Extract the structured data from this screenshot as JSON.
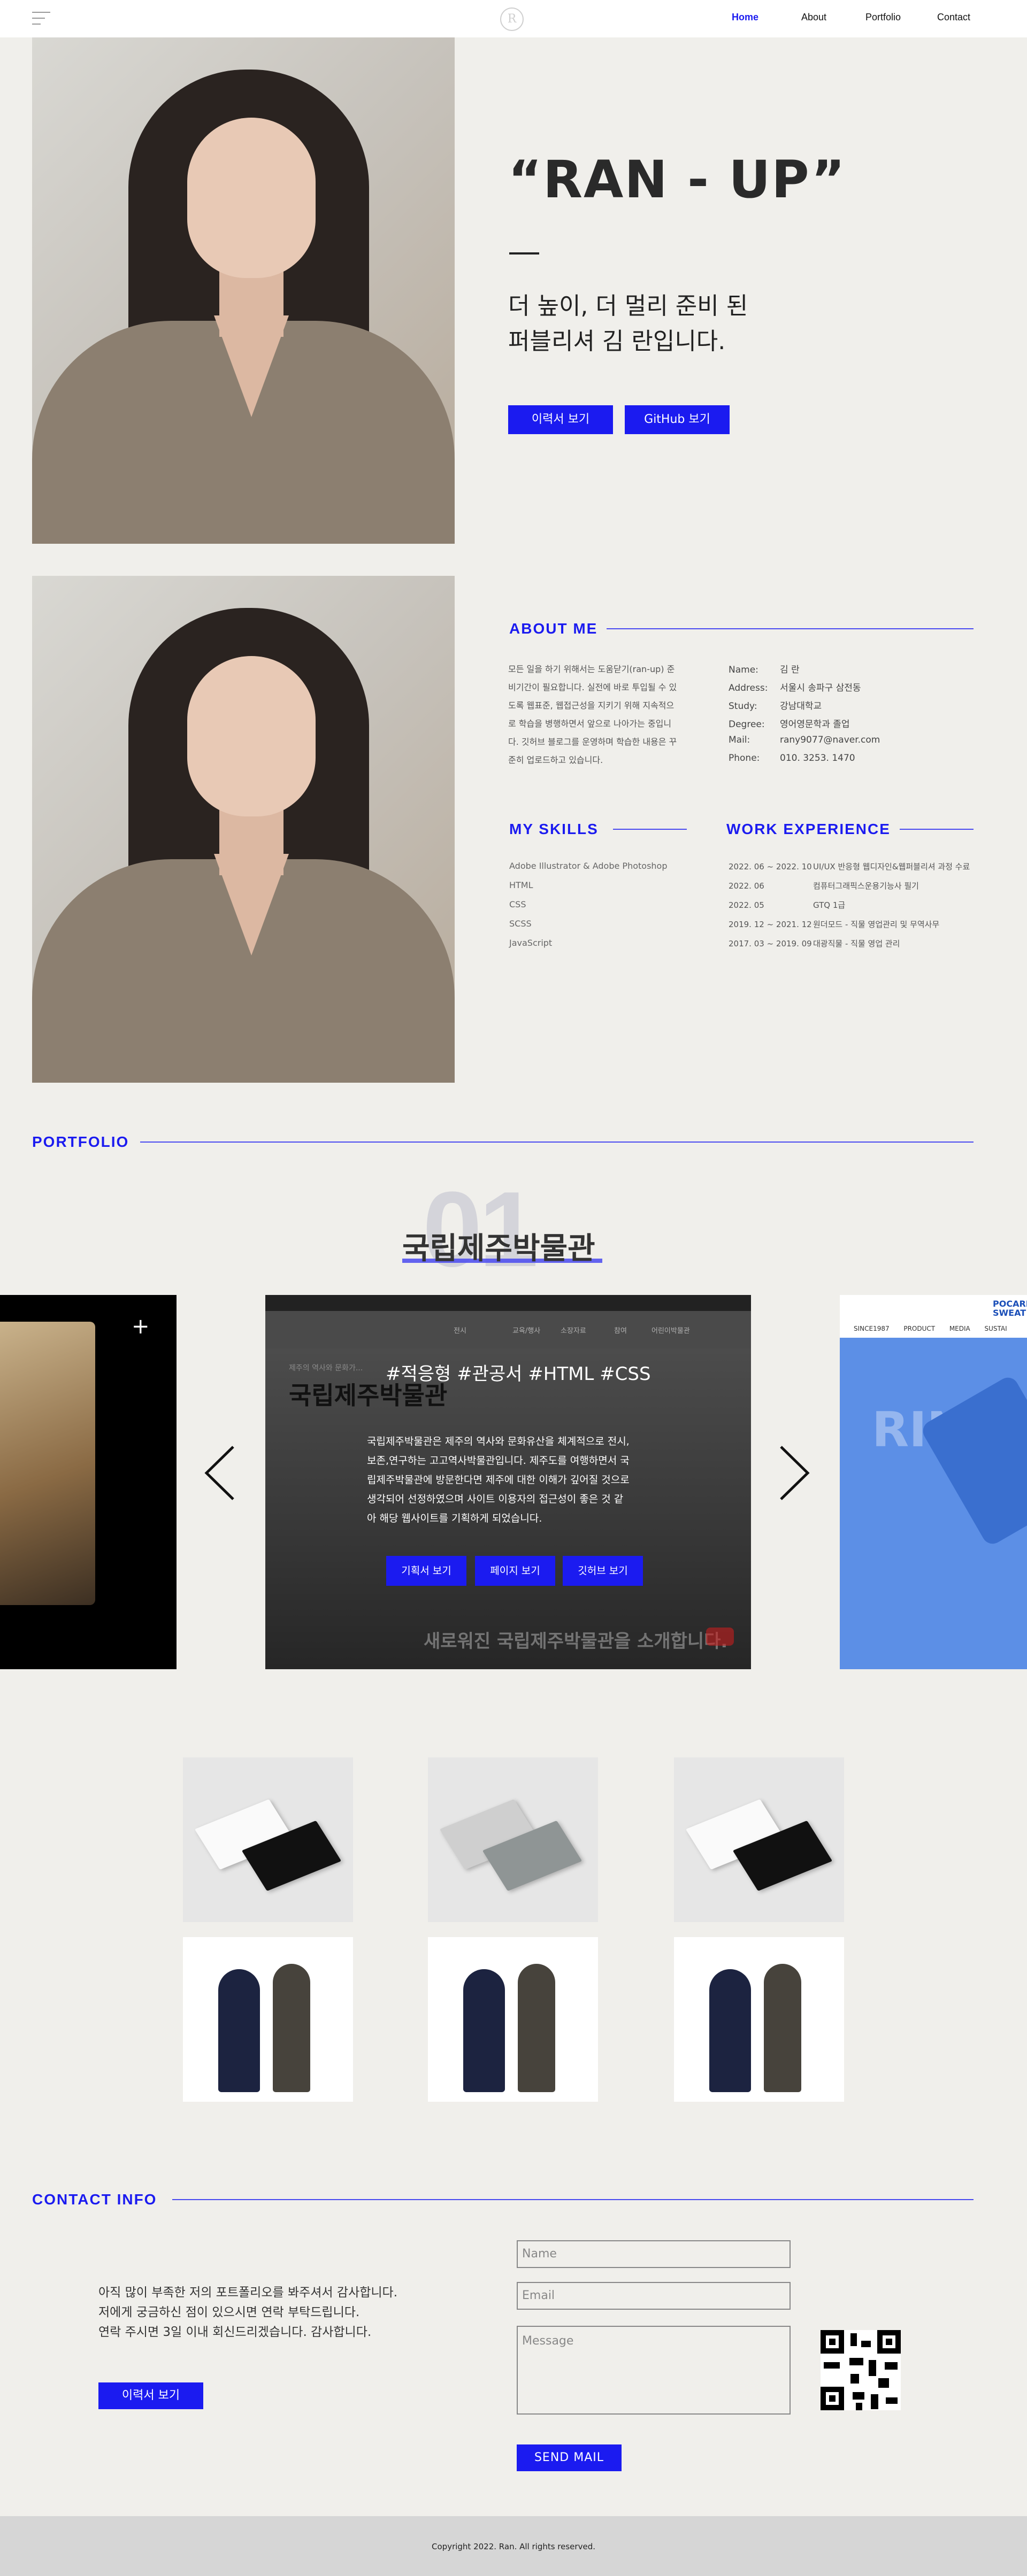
{
  "header": {
    "logo": "R",
    "nav": [
      "Home",
      "About",
      "Portfolio",
      "Contact"
    ]
  },
  "hero": {
    "title": "“RAN - UP”",
    "subtitle_line1": "더 높이, 더 멀리 준비 된",
    "subtitle_line2": "퍼블리셔 김 란입니다.",
    "btn_resume": "이력서 보기",
    "btn_github": "GitHub 보기"
  },
  "about": {
    "title": "ABOUT ME",
    "text": [
      "모든 일을 하기 위해서는 도움닫기(ran-up) 준",
      "비기간이 필요합니다.  실전에 바로 투입될 수 있",
      "도록 웹표준, 웹접근성을 지키기 위해 지속적으",
      "로 학습을 병행하면서 앞으로 나아가는 중입니",
      "다. 깃허브 블로그를 운영하며 학습한 내용은 꾸",
      "준히 업로드하고 있습니다."
    ],
    "info": [
      {
        "label": "Name:",
        "value": "김 란"
      },
      {
        "label": "Address:",
        "value": "서울시 송파구 삼전동"
      },
      {
        "label": "Study:",
        "value": "강남대학교"
      },
      {
        "label": "Degree:",
        "value": "영어영문학과 졸업"
      },
      {
        "label": "Mail:",
        "value": "rany9077@naver.com"
      },
      {
        "label": "Phone:",
        "value": "010. 3253. 1470"
      }
    ]
  },
  "skills": {
    "title": "MY SKILLS",
    "items": [
      "Adobe Illustrator & Adobe Photoshop",
      "HTML",
      "CSS",
      "SCSS",
      "JavaScript"
    ]
  },
  "work": {
    "title": "WORK EXPERIENCE",
    "items": [
      {
        "date": "2022. 06 ~ 2022. 10",
        "desc": "UI/UX 반응형 웹디자인&웹퍼블리셔 과정 수료"
      },
      {
        "date": "2022. 06",
        "desc": "컴퓨터그래픽스운용기능사 필기"
      },
      {
        "date": "2022. 05",
        "desc": "GTQ 1급"
      },
      {
        "date": "2019. 12 ~ 2021. 12",
        "desc": "원더모드 - 직물 영업관리 및 무역사무"
      },
      {
        "date": "2017. 03 ~ 2019. 09",
        "desc": "대광직물 - 직물 영업 관리"
      }
    ]
  },
  "portfolio": {
    "title": "PORTFOLIO",
    "number": "01",
    "project_title": "국립제주박물관",
    "tags": "#적응형 #관공서 #HTML #CSS",
    "slide_heading": "국립제주박물관",
    "slide_desc": [
      "국립제주박물관은 제주의 역사와 문화유산을 체계적으로 전시,",
      "보존,연구하는 고고역사박물관입니다. 제주도를 여행하면서 국",
      "립제주박물관에 방문한다면 제주에 대한 이해가 깊어질 것으로",
      "생각되어 선정하였으며 사이트 이용자의 접근성이 좋은 것 같",
      "아 해당 웹사이트를 기획하게 되었습니다."
    ],
    "btn_plan": "기획서 보기",
    "btn_page": "페이지 보기",
    "btn_github": "깃허브 보기",
    "ghost_text": "새로워진 국립제주박물관을 소개합니다.",
    "ghost_kicker": "제주의 역사와 문화가...",
    "ghost_nav": [
      "전시",
      "교육/행사",
      "소장자료",
      "참여",
      "어린이박물관"
    ],
    "right_nav": [
      "SINCE1987",
      "PRODUCT",
      "MEDIA",
      "SUSTAI"
    ],
    "right_brand": "POCARI SWEAT"
  },
  "contact": {
    "title": "CONTACT INFO",
    "text": [
      "아직 많이 부족한 저의 포트폴리오를 봐주셔서 감사합니다.",
      "저에게 궁금하신 점이 있으시면 연락 부탁드립니다.",
      "연락 주시면 3일 이내 회신드리겠습니다. 감사합니다."
    ],
    "btn_resume": "이력서 보기",
    "name_placeholder": "Name",
    "email_placeholder": "Email",
    "message_placeholder": "Message",
    "btn_send": "SEND MAIL"
  },
  "footer": {
    "text": "Copyright 2022. Ran. All rights reserved."
  },
  "colors": {
    "accent": "#1b1bf0",
    "background": "#f0efeb"
  }
}
